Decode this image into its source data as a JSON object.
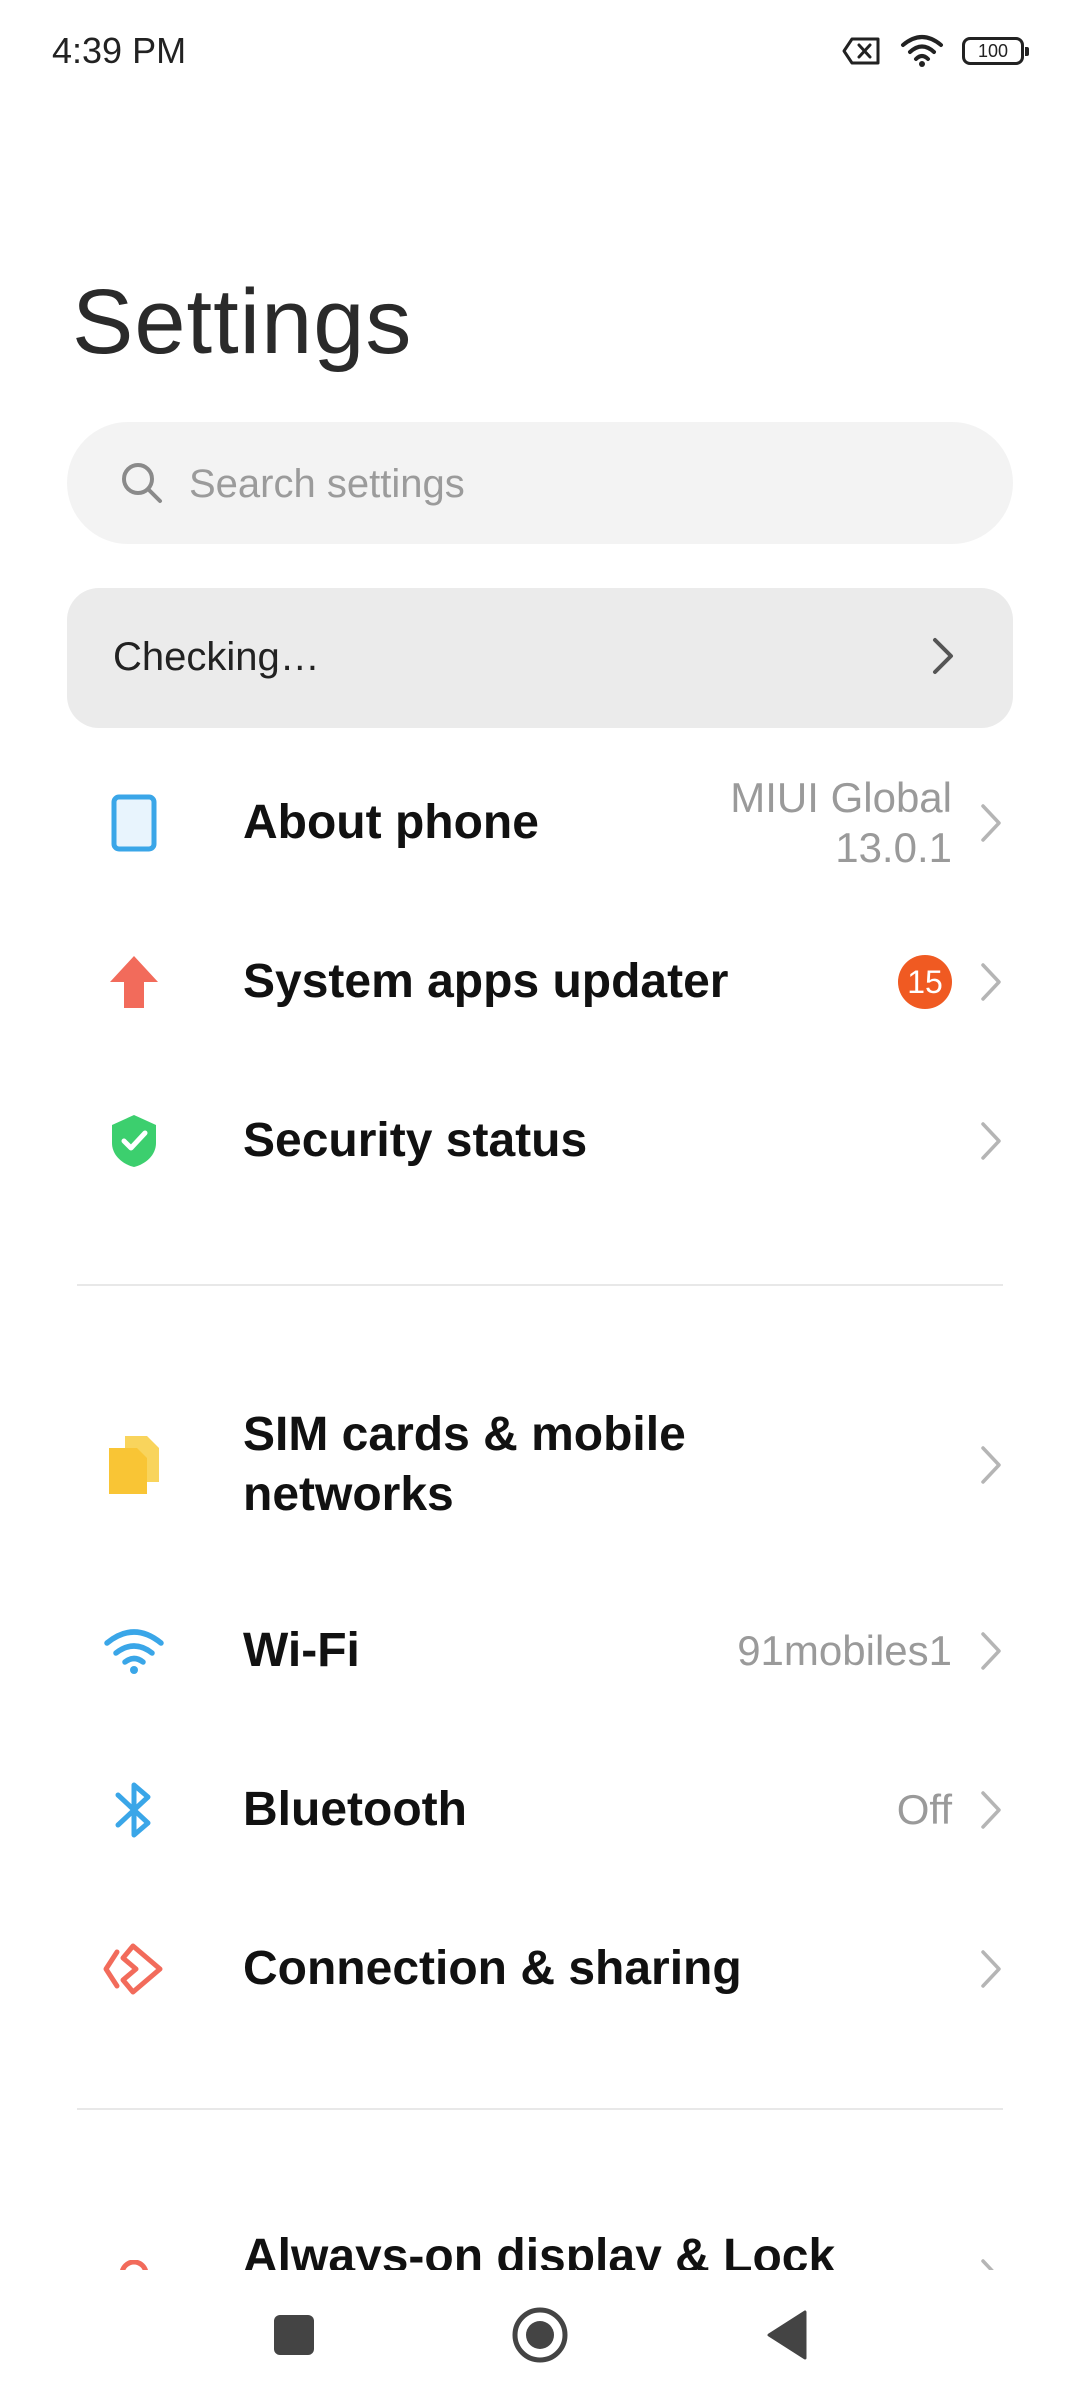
{
  "status_bar": {
    "time": "4:39 PM",
    "icons": [
      "no-sim-icon",
      "wifi-icon",
      "battery-icon"
    ],
    "battery_level": "100"
  },
  "page": {
    "title": "Settings"
  },
  "search": {
    "placeholder": "Search settings",
    "value": ""
  },
  "banner": {
    "label": "Checking…"
  },
  "items": [
    {
      "label": "About phone",
      "value_line1": "MIUI Global",
      "value_line2": "13.0.1",
      "icon": "phone-icon",
      "color": "#3aa6e8"
    },
    {
      "label": "System apps updater",
      "badge": "15",
      "icon": "arrow-up-icon",
      "color": "#f26b5b"
    },
    {
      "label": "Security status",
      "icon": "shield-check-icon",
      "color": "#3ccf6e"
    },
    {
      "label_line1": "SIM cards & mobile",
      "label_line2": "networks",
      "icon": "sim-card-icon",
      "color": "#f9c535"
    },
    {
      "label": "Wi-Fi",
      "value": "91mobiles1",
      "icon": "wifi-icon",
      "color": "#3aa6e8"
    },
    {
      "label": "Bluetooth",
      "value": "Off",
      "icon": "bluetooth-icon",
      "color": "#3aa6e8"
    },
    {
      "label": "Connection & sharing",
      "icon": "connection-sharing-icon",
      "color": "#f26b5b"
    },
    {
      "label": "Always-on display & Lock",
      "icon": "lock-icon",
      "color": "#f26b5b"
    }
  ],
  "nav": {
    "buttons": [
      "recents-square-icon",
      "home-circle-icon",
      "back-triangle-icon"
    ]
  }
}
